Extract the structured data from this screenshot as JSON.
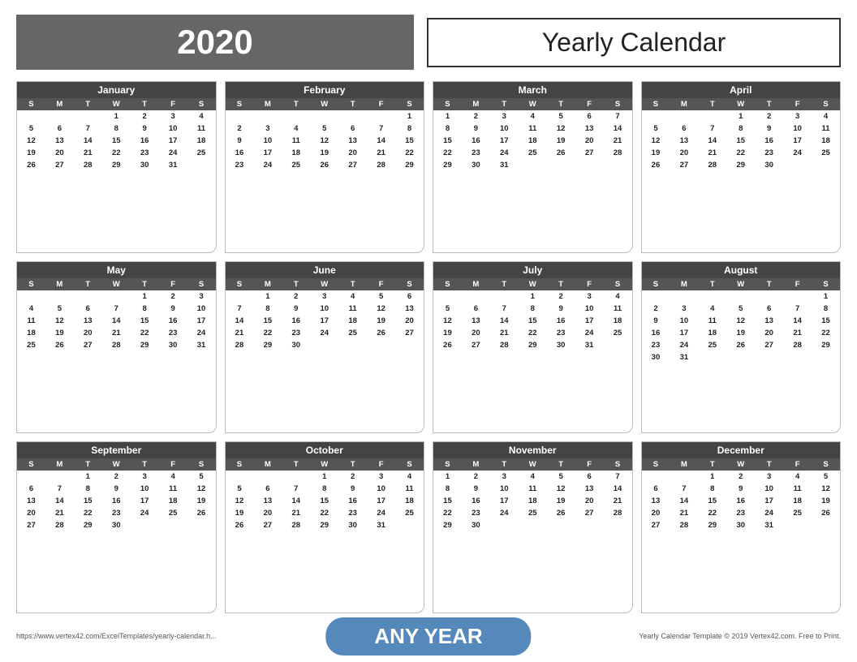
{
  "header": {
    "year": "2020",
    "title": "Yearly Calendar"
  },
  "footer": {
    "left": "https://www.vertex42.com/ExcelTemplates/yearly-calendar.h...",
    "center": "ANY YEAR",
    "right": "Yearly Calendar Template © 2019 Vertex42.com. Free to Print."
  },
  "months": [
    {
      "name": "January",
      "days": [
        "",
        "",
        "",
        "1",
        "2",
        "3",
        "4",
        "5",
        "6",
        "7",
        "8",
        "9",
        "10",
        "11",
        "12",
        "13",
        "14",
        "15",
        "16",
        "17",
        "18",
        "19",
        "20",
        "21",
        "22",
        "23",
        "24",
        "25",
        "26",
        "27",
        "28",
        "29",
        "30",
        "31"
      ]
    },
    {
      "name": "February",
      "days": [
        "",
        "",
        "",
        "",
        "",
        "",
        "1",
        "2",
        "3",
        "4",
        "5",
        "6",
        "7",
        "8",
        "9",
        "10",
        "11",
        "12",
        "13",
        "14",
        "15",
        "16",
        "17",
        "18",
        "19",
        "20",
        "21",
        "22",
        "23",
        "24",
        "25",
        "26",
        "27",
        "28",
        "29"
      ]
    },
    {
      "name": "March",
      "days": [
        "1",
        "2",
        "3",
        "4",
        "5",
        "6",
        "7",
        "8",
        "9",
        "10",
        "11",
        "12",
        "13",
        "14",
        "15",
        "16",
        "17",
        "18",
        "19",
        "20",
        "21",
        "22",
        "23",
        "24",
        "25",
        "26",
        "27",
        "28",
        "29",
        "30",
        "31"
      ]
    },
    {
      "name": "April",
      "days": [
        "",
        "",
        "",
        "1",
        "2",
        "3",
        "4",
        "5",
        "6",
        "7",
        "8",
        "9",
        "10",
        "11",
        "12",
        "13",
        "14",
        "15",
        "16",
        "17",
        "18",
        "19",
        "20",
        "21",
        "22",
        "23",
        "24",
        "25",
        "26",
        "27",
        "28",
        "29",
        "30"
      ]
    },
    {
      "name": "May",
      "days": [
        "",
        "",
        "",
        "",
        "1",
        "2",
        "3",
        "4",
        "5",
        "6",
        "7",
        "8",
        "9",
        "10",
        "11",
        "12",
        "13",
        "14",
        "15",
        "16",
        "17",
        "18",
        "19",
        "20",
        "21",
        "22",
        "23",
        "24",
        "25",
        "26",
        "27",
        "28",
        "29",
        "30",
        "31"
      ]
    },
    {
      "name": "June",
      "days": [
        "",
        "1",
        "2",
        "3",
        "4",
        "5",
        "6",
        "7",
        "8",
        "9",
        "10",
        "11",
        "12",
        "13",
        "14",
        "15",
        "16",
        "17",
        "18",
        "19",
        "20",
        "21",
        "22",
        "23",
        "24",
        "25",
        "26",
        "27",
        "28",
        "29",
        "30"
      ]
    },
    {
      "name": "July",
      "days": [
        "",
        "",
        "",
        "1",
        "2",
        "3",
        "4",
        "5",
        "6",
        "7",
        "8",
        "9",
        "10",
        "11",
        "12",
        "13",
        "14",
        "15",
        "16",
        "17",
        "18",
        "19",
        "20",
        "21",
        "22",
        "23",
        "24",
        "25",
        "26",
        "27",
        "28",
        "29",
        "30",
        "31"
      ]
    },
    {
      "name": "August",
      "days": [
        "",
        "",
        "",
        "",
        "",
        "",
        "1",
        "2",
        "3",
        "4",
        "5",
        "6",
        "7",
        "8",
        "9",
        "10",
        "11",
        "12",
        "13",
        "14",
        "15",
        "16",
        "17",
        "18",
        "19",
        "20",
        "21",
        "22",
        "23",
        "24",
        "25",
        "26",
        "27",
        "28",
        "29",
        "30",
        "31"
      ]
    },
    {
      "name": "September",
      "days": [
        "",
        "",
        "1",
        "2",
        "3",
        "4",
        "5",
        "6",
        "7",
        "8",
        "9",
        "10",
        "11",
        "12",
        "13",
        "14",
        "15",
        "16",
        "17",
        "18",
        "19",
        "20",
        "21",
        "22",
        "23",
        "24",
        "25",
        "26",
        "27",
        "28",
        "29",
        "30"
      ]
    },
    {
      "name": "October",
      "days": [
        "",
        "",
        "",
        "1",
        "2",
        "3",
        "4",
        "5",
        "6",
        "7",
        "8",
        "9",
        "10",
        "11",
        "12",
        "13",
        "14",
        "15",
        "16",
        "17",
        "18",
        "19",
        "20",
        "21",
        "22",
        "23",
        "24",
        "25",
        "26",
        "27",
        "28",
        "29",
        "30",
        "31"
      ]
    },
    {
      "name": "November",
      "days": [
        "1",
        "2",
        "3",
        "4",
        "5",
        "6",
        "7",
        "8",
        "9",
        "10",
        "11",
        "12",
        "13",
        "14",
        "15",
        "16",
        "17",
        "18",
        "19",
        "20",
        "21",
        "22",
        "23",
        "24",
        "25",
        "26",
        "27",
        "28",
        "29",
        "30"
      ]
    },
    {
      "name": "December",
      "days": [
        "",
        "",
        "1",
        "2",
        "3",
        "4",
        "5",
        "6",
        "7",
        "8",
        "9",
        "10",
        "11",
        "12",
        "13",
        "14",
        "15",
        "16",
        "17",
        "18",
        "19",
        "20",
        "21",
        "22",
        "23",
        "24",
        "25",
        "26",
        "27",
        "28",
        "29",
        "30",
        "31"
      ]
    }
  ],
  "dayLabels": [
    "S",
    "M",
    "T",
    "W",
    "T",
    "F",
    "S"
  ]
}
